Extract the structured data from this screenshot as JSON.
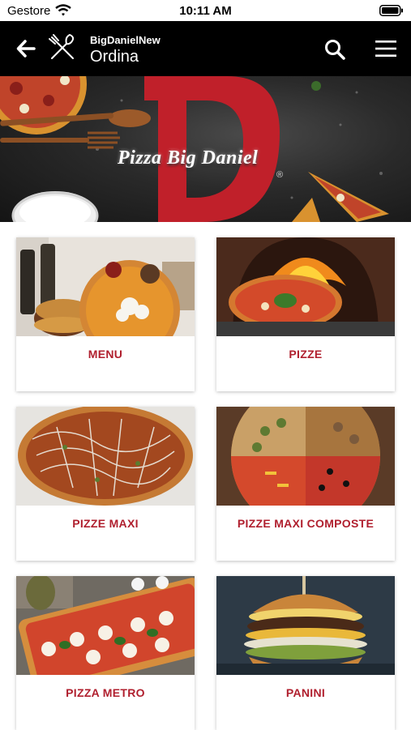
{
  "status_bar": {
    "carrier": "Gestore",
    "time": "10:11 AM"
  },
  "header": {
    "subtitle": "BigDanielNew",
    "title": "Ordina"
  },
  "hero": {
    "brand": "Pizza Big Daniel",
    "logo_letter": "D",
    "registered": "®"
  },
  "categories": [
    {
      "label": "MENU"
    },
    {
      "label": "PIZZE"
    },
    {
      "label": "PIZZE MAXI"
    },
    {
      "label": "PIZZE MAXI COMPOSTE"
    },
    {
      "label": "PIZZA METRO"
    },
    {
      "label": "PANINI"
    }
  ],
  "colors": {
    "accent": "#b01f2e",
    "header_bg": "#000000",
    "logo_red": "#c0202a"
  },
  "icons": [
    "wifi-icon",
    "battery-icon",
    "back-arrow-icon",
    "utensils-icon",
    "search-icon",
    "hamburger-menu-icon"
  ]
}
